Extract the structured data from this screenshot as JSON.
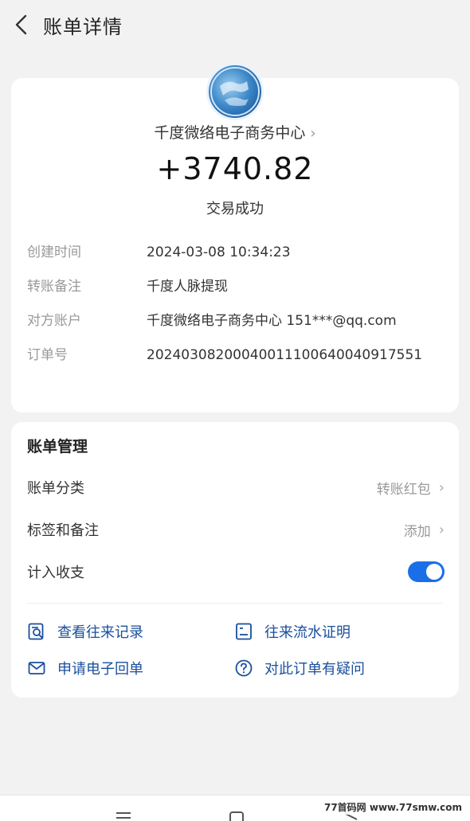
{
  "header": {
    "title": "账单详情"
  },
  "detail": {
    "merchant": "千度微络电子商务中心",
    "amount": "+3740.82",
    "status": "交易成功",
    "rows": [
      {
        "label": "创建时间",
        "value": "2024-03-08 10:34:23"
      },
      {
        "label": "转账备注",
        "value": "千度人脉提现"
      },
      {
        "label": "对方账户",
        "value": "千度微络电子商务中心 151***@qq.com"
      },
      {
        "label": "订单号",
        "value": "20240308200040011100640040917551"
      }
    ]
  },
  "manage": {
    "title": "账单管理",
    "category": {
      "label": "账单分类",
      "value": "转账红包"
    },
    "tags": {
      "label": "标签和备注",
      "value": "添加"
    },
    "include": {
      "label": "计入收支",
      "enabled": true
    },
    "actions": [
      {
        "label": "查看往来记录",
        "icon": "search-record-icon"
      },
      {
        "label": "往来流水证明",
        "icon": "statement-icon"
      },
      {
        "label": "申请电子回单",
        "icon": "mail-icon"
      },
      {
        "label": "对此订单有疑问",
        "icon": "question-icon"
      }
    ]
  },
  "watermark": "77首码网 www.77smw.com",
  "colors": {
    "accent": "#1a6fe8",
    "link": "#1a4f9c",
    "background": "#f2f2f2"
  }
}
